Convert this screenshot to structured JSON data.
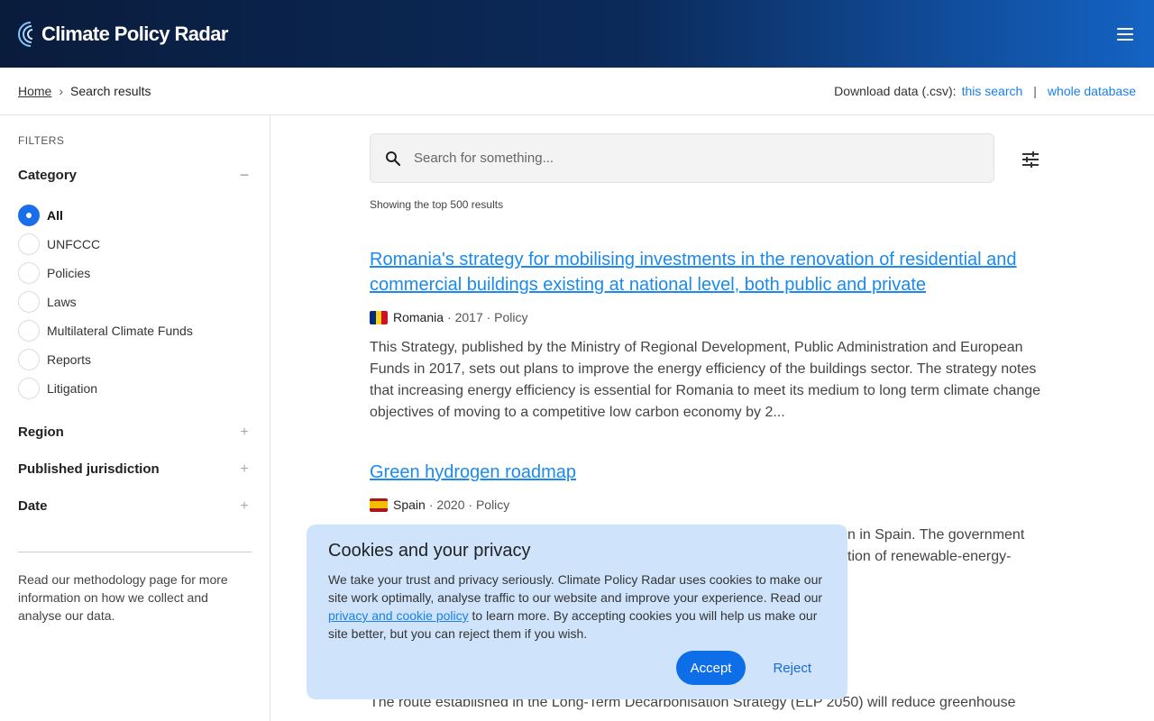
{
  "header": {
    "logo_text": "Climate Policy Radar",
    "logo_icon": "radar-logo-icon",
    "menu_icon": "hamburger-menu-icon"
  },
  "breadcrumb": {
    "home": "Home",
    "separator": "›",
    "current": "Search results"
  },
  "download": {
    "label": "Download data (.csv):",
    "this_search": "this search",
    "divider": "|",
    "whole_database": "whole database"
  },
  "sidebar": {
    "filters_title": "FILTERS",
    "category": {
      "title": "Category",
      "toggle": "−",
      "selected": "All",
      "options": [
        "All",
        "UNFCCC",
        "Policies",
        "Laws",
        "Multilateral Climate Funds",
        "Reports",
        "Litigation"
      ]
    },
    "sections": [
      {
        "title": "Region",
        "toggle": "+"
      },
      {
        "title": "Published jurisdiction",
        "toggle": "+"
      },
      {
        "title": "Date",
        "toggle": "+"
      }
    ],
    "note": "Read our methodology page for more information on how we collect and analyse our data."
  },
  "search": {
    "placeholder": "Search for something...",
    "value": "",
    "result_count": "Showing the top 500 results"
  },
  "results": [
    {
      "title": "Romania's strategy for mobilising investments in the renovation of residential and commercial buildings existing at national level, both public and private",
      "country": "Romania",
      "year": "2017",
      "type": "Policy",
      "meta_rest": "· 2017 · Policy",
      "flag_colors": [
        "#002b7f",
        "#fcd116",
        "#ce1126"
      ],
      "description": "This Strategy, published by the Ministry of Regional Development, Public Administration and European Funds in 2017, sets out plans to improve the energy efficiency of the buildings sector. The strategy notes that increasing energy efficiency is essential for Romania to meet its medium to long term climate change objectives of moving to a competitive low carbon economy by 2..."
    },
    {
      "title": "Green hydrogen roadmap",
      "country": "Spain",
      "year": "2020",
      "type": "Policy",
      "meta_rest": "· 2020 · Policy",
      "flag_colors": [
        "#aa151b",
        "#f1bf00",
        "#aa151b"
      ],
      "description_visible": "n in Spain. The government",
      "description_visible_2": "tion of renewable-energy-"
    },
    {
      "description_partial": "The route established in the Long-Term Decarbonisation Strategy (ELP 2050) will reduce greenhouse"
    }
  ],
  "cookie": {
    "title": "Cookies and your privacy",
    "text_before": "We take your trust and privacy seriously. Climate Policy Radar uses cookies to make our site work optimally, analyse traffic to our website and improve your experience. Read our ",
    "link": "privacy and cookie policy",
    "text_after": " to learn more. By accepting cookies you will help us make our site better, but you can reject them if you wish.",
    "accept": "Accept",
    "reject": "Reject"
  },
  "colors": {
    "accent": "#1a6fe8",
    "link": "#1a8aee",
    "cookie_bg": "#cfe4fb",
    "header_dark": "#0a1c3c"
  }
}
